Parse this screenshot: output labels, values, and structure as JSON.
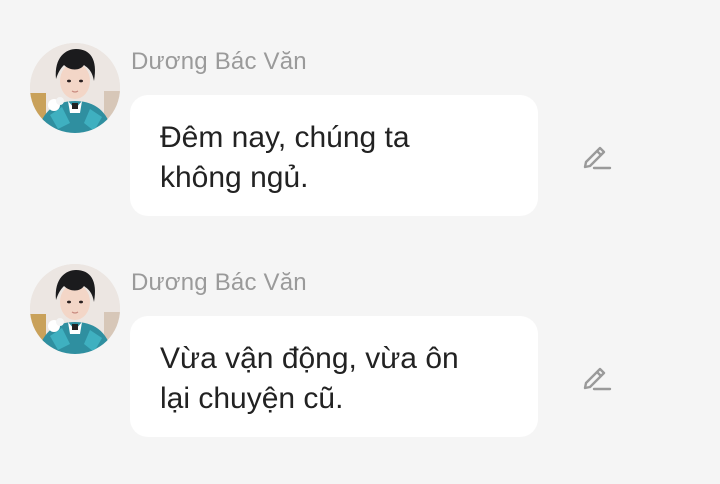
{
  "messages": [
    {
      "sender": "Dương Bác Văn",
      "text": "Đêm nay, chúng ta không ngủ.",
      "avatar_icon": "user-avatar",
      "action_icon": "pencil-edit-icon"
    },
    {
      "sender": "Dương Bác Văn",
      "text": "Vừa vận động, vừa ôn lại chuyện cũ.",
      "avatar_icon": "user-avatar",
      "action_icon": "pencil-edit-icon"
    }
  ],
  "colors": {
    "background": "#f5f5f5",
    "bubble": "#ffffff",
    "sender_name": "#9a9a9a",
    "message_text": "#222222",
    "icon": "#9a9a9a"
  }
}
